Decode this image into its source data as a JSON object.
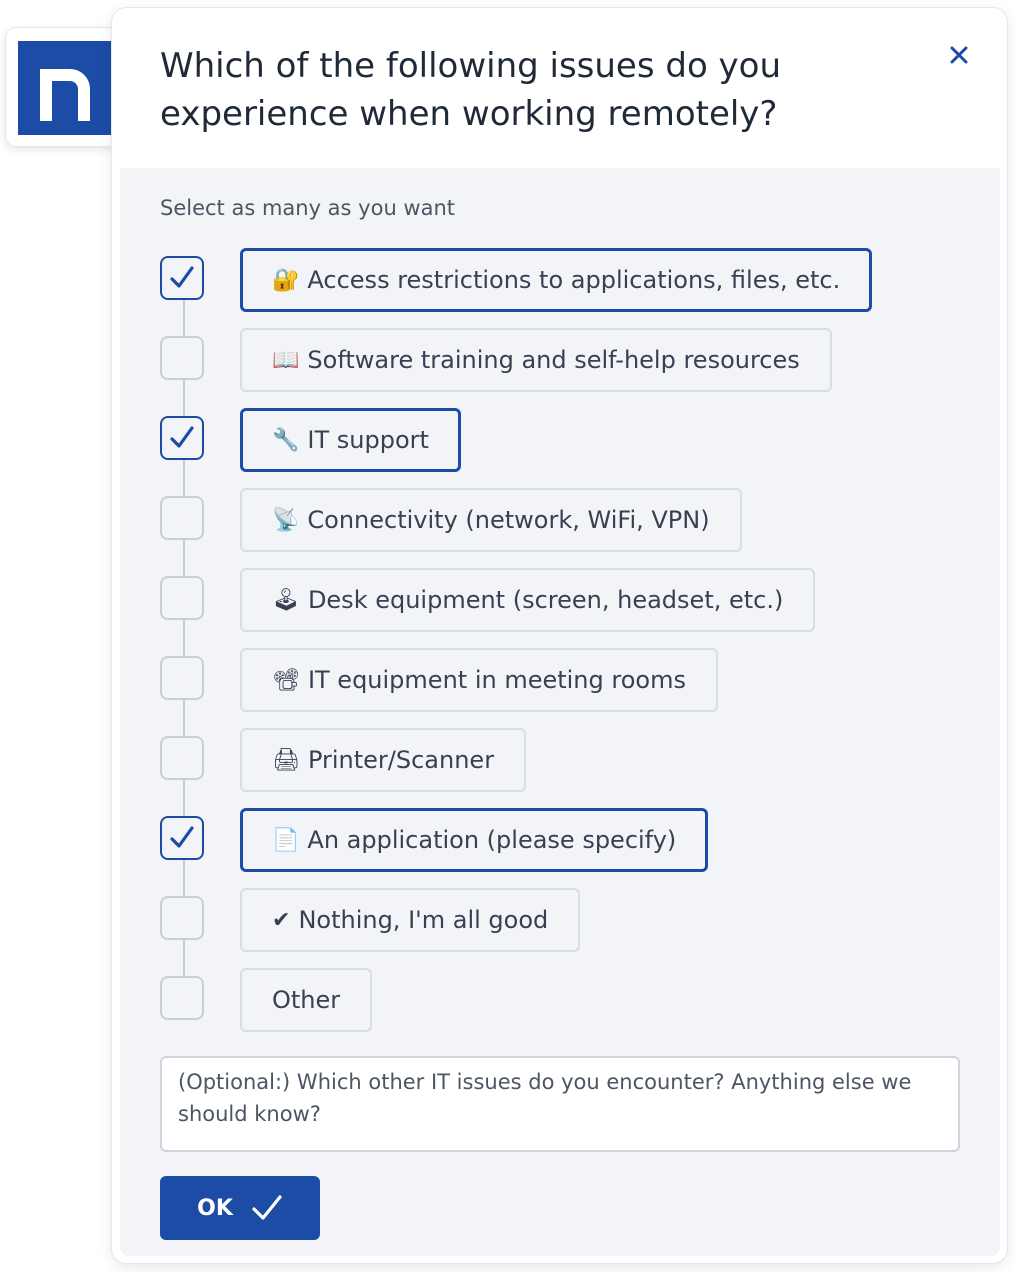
{
  "brand": {
    "color": "#1d4ca6",
    "logo_icon": "n-logo-icon"
  },
  "question": {
    "title": "Which of the following issues do you experience when working remotely?"
  },
  "close_icon": "close-icon",
  "hint": "Select as many as you want",
  "options": [
    {
      "emoji": "🔐",
      "label": "Access restrictions to applications, files, etc.",
      "checked": true
    },
    {
      "emoji": "📖",
      "label": "Software training and self-help resources",
      "checked": false
    },
    {
      "emoji": "🔧",
      "label": "IT support",
      "checked": true
    },
    {
      "emoji": "📡",
      "label": "Connectivity (network, WiFi, VPN)",
      "checked": false
    },
    {
      "emoji": "🕹",
      "label": "Desk equipment (screen, headset, etc.)",
      "checked": false
    },
    {
      "emoji": "📽",
      "label": "IT equipment in meeting rooms",
      "checked": false
    },
    {
      "emoji": "🖨",
      "label": "Printer/Scanner",
      "checked": false
    },
    {
      "emoji": "📄",
      "label": "An application (please specify)",
      "checked": true
    },
    {
      "emoji": "✔",
      "label": "Nothing, I'm all good",
      "checked": false
    },
    {
      "emoji": "",
      "label": "Other",
      "checked": false
    }
  ],
  "comment": {
    "placeholder": "(Optional:) Which other IT issues do you encounter? Anything else we should know?",
    "value": ""
  },
  "ok": {
    "label": "OK",
    "icon": "checkmark-icon"
  }
}
